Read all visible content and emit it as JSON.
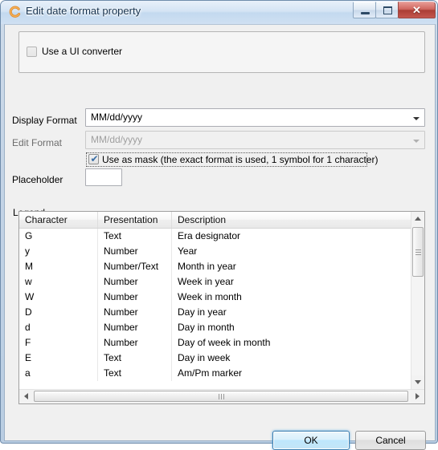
{
  "window": {
    "title": "Edit date format property",
    "icon": "ring-icon",
    "controls": {
      "minimize": "minimize-icon",
      "maximize": "maximize-icon",
      "close": "✕"
    }
  },
  "panel": {
    "ui_converter": {
      "label": "Use a UI converter",
      "checked": false,
      "enabled": false
    }
  },
  "fields": {
    "display_format": {
      "label": "Display Format",
      "value": "MM/dd/yyyy",
      "enabled": true
    },
    "edit_format": {
      "label": "Edit Format",
      "value": "MM/dd/yyyy",
      "enabled": false
    },
    "use_as_mask": {
      "label": "Use as mask (the exact format is used, 1 symbol for 1 character)",
      "checked": true,
      "focused": true,
      "tick": "✔"
    },
    "placeholder": {
      "label": "Placeholder",
      "value": ""
    }
  },
  "legend": {
    "title": "Legend",
    "columns": [
      "Character",
      "Presentation",
      "Description"
    ],
    "rows": [
      {
        "character": "G",
        "presentation": "Text",
        "description": "Era designator"
      },
      {
        "character": "y",
        "presentation": "Number",
        "description": "Year"
      },
      {
        "character": "M",
        "presentation": "Number/Text",
        "description": "Month in year"
      },
      {
        "character": "w",
        "presentation": "Number",
        "description": "Week in year"
      },
      {
        "character": "W",
        "presentation": "Number",
        "description": "Week in month"
      },
      {
        "character": "D",
        "presentation": "Number",
        "description": "Day in year"
      },
      {
        "character": "d",
        "presentation": "Number",
        "description": "Day in month"
      },
      {
        "character": "F",
        "presentation": "Number",
        "description": "Day of week in month"
      },
      {
        "character": "E",
        "presentation": "Text",
        "description": "Day in week"
      },
      {
        "character": "a",
        "presentation": "Text",
        "description": "Am/Pm marker"
      }
    ]
  },
  "buttons": {
    "ok": "OK",
    "cancel": "Cancel"
  },
  "colors": {
    "title_bar": "#d4e4f4",
    "close_button": "#ab3d35",
    "default_button_border": "#3c7fb1",
    "dialog_background": "#f0f0f0"
  }
}
